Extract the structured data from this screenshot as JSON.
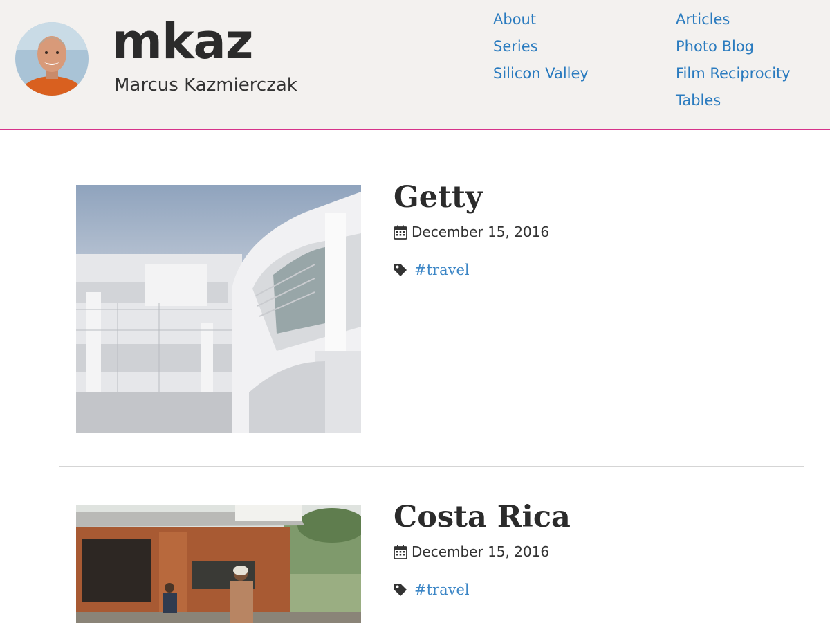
{
  "site": {
    "title": "mkaz",
    "subtitle": "Marcus Kazmierczak"
  },
  "nav": {
    "col1": [
      "About",
      "Series",
      "Silicon Valley"
    ],
    "col2": [
      "Articles",
      "Photo Blog",
      "Film Reciprocity",
      "Tables"
    ]
  },
  "posts": [
    {
      "title": "Getty",
      "date": "December 15, 2016",
      "tag": "#travel"
    },
    {
      "title": "Costa Rica",
      "date": "December 15, 2016",
      "tag": "#travel"
    }
  ],
  "colors": {
    "header_bg": "#f3f1ef",
    "header_border": "#d6338a",
    "link": "#2a7bbf",
    "tag_link": "#3c86c6",
    "text": "#333333"
  },
  "icons": {
    "date": "calendar-icon",
    "tag": "tag-icon"
  }
}
